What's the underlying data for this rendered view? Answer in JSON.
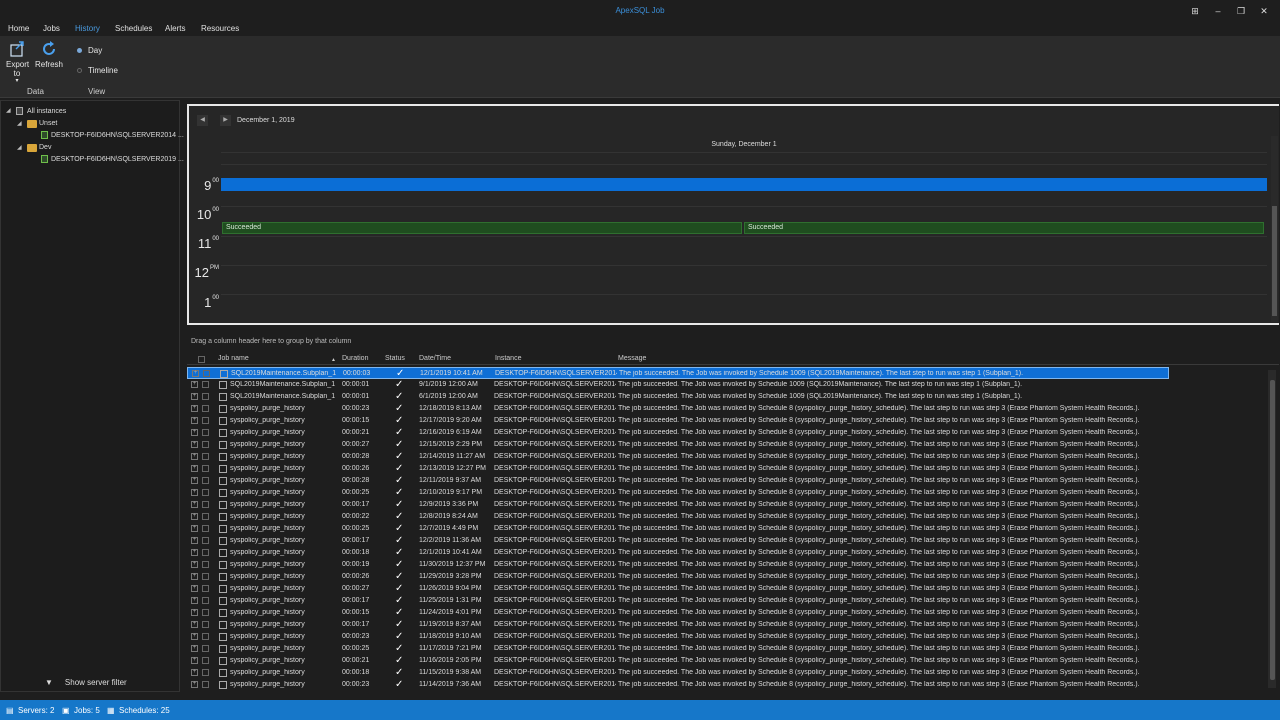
{
  "app": {
    "title": "ApexSQL Job"
  },
  "window": {
    "pin": "⊞",
    "minimize": "–",
    "restore": "❐",
    "close": "✕"
  },
  "menu": [
    "Home",
    "Jobs",
    "History",
    "Schedules",
    "Alerts",
    "Resources"
  ],
  "ribbon": {
    "export_label": "Export to",
    "export_arrow": "▾",
    "refresh_label": "Refresh",
    "day_label": "Day",
    "timeline_label": "Timeline",
    "group_data": "Data",
    "group_view": "View"
  },
  "tree": {
    "root": "All instances",
    "groups": [
      {
        "name": "Unset",
        "server": "DESKTOP-F6ID6HN\\SQLSERVER2014 ..."
      },
      {
        "name": "Dev",
        "server": "DESKTOP-F6ID6HN\\SQLSERVER2019 ..."
      }
    ]
  },
  "filter_label": "Show server filter",
  "calendar": {
    "date": "December 1, 2019",
    "day_header": "Sunday, December 1",
    "hours": [
      {
        "h": "9",
        "s": "00"
      },
      {
        "h": "10",
        "s": "00"
      },
      {
        "h": "11",
        "s": "00"
      },
      {
        "h": "12",
        "s": "PM"
      },
      {
        "h": "1",
        "s": "00"
      }
    ],
    "events": [
      "Succeeded",
      "Succeeded"
    ]
  },
  "grid": {
    "group_hint": "Drag a column header here to group by that column",
    "columns": [
      "Job name",
      "Duration",
      "Status",
      "Date/Time",
      "Instance",
      "Message"
    ],
    "sort_arrow": "▲",
    "status_glyph": "✓",
    "rows": [
      {
        "job": "SQL2019Maintenance.Subplan_1",
        "dur": "00:00:03",
        "dt": "12/1/2019 10:41 AM",
        "inst": "DESKTOP-F6ID6HN\\SQLSERVER2014",
        "msg": "The job succeeded.  The Job was invoked by Schedule 1009 (SQL2019Maintenance).  The last step to run was step 1 (Subplan_1)."
      },
      {
        "job": "SQL2019Maintenance.Subplan_1",
        "dur": "00:00:01",
        "dt": "9/1/2019 12:00 AM",
        "inst": "DESKTOP-F6ID6HN\\SQLSERVER2014",
        "msg": "The job succeeded.  The Job was invoked by Schedule 1009 (SQL2019Maintenance).  The last step to run was step 1 (Subplan_1)."
      },
      {
        "job": "SQL2019Maintenance.Subplan_1",
        "dur": "00:00:01",
        "dt": "6/1/2019 12:00 AM",
        "inst": "DESKTOP-F6ID6HN\\SQLSERVER2014",
        "msg": "The job succeeded.  The Job was invoked by Schedule 1009 (SQL2019Maintenance).  The last step to run was step 1 (Subplan_1)."
      },
      {
        "job": "syspolicy_purge_history",
        "dur": "00:00:23",
        "dt": "12/18/2019 8:13 AM",
        "inst": "DESKTOP-F6ID6HN\\SQLSERVER2014",
        "msg": "The job succeeded.  The Job was invoked by Schedule 8 (syspolicy_purge_history_schedule).  The last step to run was step 3 (Erase Phantom System Health Records.)."
      },
      {
        "job": "syspolicy_purge_history",
        "dur": "00:00:15",
        "dt": "12/17/2019 9:20 AM",
        "inst": "DESKTOP-F6ID6HN\\SQLSERVER2014",
        "msg": "The job succeeded.  The Job was invoked by Schedule 8 (syspolicy_purge_history_schedule).  The last step to run was step 3 (Erase Phantom System Health Records.)."
      },
      {
        "job": "syspolicy_purge_history",
        "dur": "00:00:21",
        "dt": "12/16/2019 6:19 AM",
        "inst": "DESKTOP-F6ID6HN\\SQLSERVER2014",
        "msg": "The job succeeded.  The Job was invoked by Schedule 8 (syspolicy_purge_history_schedule).  The last step to run was step 3 (Erase Phantom System Health Records.)."
      },
      {
        "job": "syspolicy_purge_history",
        "dur": "00:00:27",
        "dt": "12/15/2019 2:29 PM",
        "inst": "DESKTOP-F6ID6HN\\SQLSERVER2014",
        "msg": "The job succeeded.  The Job was invoked by Schedule 8 (syspolicy_purge_history_schedule).  The last step to run was step 3 (Erase Phantom System Health Records.)."
      },
      {
        "job": "syspolicy_purge_history",
        "dur": "00:00:28",
        "dt": "12/14/2019 11:27 AM",
        "inst": "DESKTOP-F6ID6HN\\SQLSERVER2014",
        "msg": "The job succeeded.  The Job was invoked by Schedule 8 (syspolicy_purge_history_schedule).  The last step to run was step 3 (Erase Phantom System Health Records.)."
      },
      {
        "job": "syspolicy_purge_history",
        "dur": "00:00:26",
        "dt": "12/13/2019 12:27 PM",
        "inst": "DESKTOP-F6ID6HN\\SQLSERVER2014",
        "msg": "The job succeeded.  The Job was invoked by Schedule 8 (syspolicy_purge_history_schedule).  The last step to run was step 3 (Erase Phantom System Health Records.)."
      },
      {
        "job": "syspolicy_purge_history",
        "dur": "00:00:28",
        "dt": "12/11/2019 9:37 AM",
        "inst": "DESKTOP-F6ID6HN\\SQLSERVER2014",
        "msg": "The job succeeded.  The Job was invoked by Schedule 8 (syspolicy_purge_history_schedule).  The last step to run was step 3 (Erase Phantom System Health Records.)."
      },
      {
        "job": "syspolicy_purge_history",
        "dur": "00:00:25",
        "dt": "12/10/2019 9:17 PM",
        "inst": "DESKTOP-F6ID6HN\\SQLSERVER2014",
        "msg": "The job succeeded.  The Job was invoked by Schedule 8 (syspolicy_purge_history_schedule).  The last step to run was step 3 (Erase Phantom System Health Records.)."
      },
      {
        "job": "syspolicy_purge_history",
        "dur": "00:00:17",
        "dt": "12/9/2019 3:36 PM",
        "inst": "DESKTOP-F6ID6HN\\SQLSERVER2014",
        "msg": "The job succeeded.  The Job was invoked by Schedule 8 (syspolicy_purge_history_schedule).  The last step to run was step 3 (Erase Phantom System Health Records.)."
      },
      {
        "job": "syspolicy_purge_history",
        "dur": "00:00:22",
        "dt": "12/8/2019 8:24 AM",
        "inst": "DESKTOP-F6ID6HN\\SQLSERVER2014",
        "msg": "The job succeeded.  The Job was invoked by Schedule 8 (syspolicy_purge_history_schedule).  The last step to run was step 3 (Erase Phantom System Health Records.)."
      },
      {
        "job": "syspolicy_purge_history",
        "dur": "00:00:25",
        "dt": "12/7/2019 4:49 PM",
        "inst": "DESKTOP-F6ID6HN\\SQLSERVER2014",
        "msg": "The job succeeded.  The Job was invoked by Schedule 8 (syspolicy_purge_history_schedule).  The last step to run was step 3 (Erase Phantom System Health Records.)."
      },
      {
        "job": "syspolicy_purge_history",
        "dur": "00:00:17",
        "dt": "12/2/2019 11:36 AM",
        "inst": "DESKTOP-F6ID6HN\\SQLSERVER2014",
        "msg": "The job succeeded.  The Job was invoked by Schedule 8 (syspolicy_purge_history_schedule).  The last step to run was step 3 (Erase Phantom System Health Records.)."
      },
      {
        "job": "syspolicy_purge_history",
        "dur": "00:00:18",
        "dt": "12/1/2019 10:41 AM",
        "inst": "DESKTOP-F6ID6HN\\SQLSERVER2014",
        "msg": "The job succeeded.  The Job was invoked by Schedule 8 (syspolicy_purge_history_schedule).  The last step to run was step 3 (Erase Phantom System Health Records.)."
      },
      {
        "job": "syspolicy_purge_history",
        "dur": "00:00:19",
        "dt": "11/30/2019 12:37 PM",
        "inst": "DESKTOP-F6ID6HN\\SQLSERVER2014",
        "msg": "The job succeeded.  The Job was invoked by Schedule 8 (syspolicy_purge_history_schedule).  The last step to run was step 3 (Erase Phantom System Health Records.)."
      },
      {
        "job": "syspolicy_purge_history",
        "dur": "00:00:26",
        "dt": "11/29/2019 3:28 PM",
        "inst": "DESKTOP-F6ID6HN\\SQLSERVER2014",
        "msg": "The job succeeded.  The Job was invoked by Schedule 8 (syspolicy_purge_history_schedule).  The last step to run was step 3 (Erase Phantom System Health Records.)."
      },
      {
        "job": "syspolicy_purge_history",
        "dur": "00:00:27",
        "dt": "11/26/2019 9:04 PM",
        "inst": "DESKTOP-F6ID6HN\\SQLSERVER2014",
        "msg": "The job succeeded.  The Job was invoked by Schedule 8 (syspolicy_purge_history_schedule).  The last step to run was step 3 (Erase Phantom System Health Records.)."
      },
      {
        "job": "syspolicy_purge_history",
        "dur": "00:00:17",
        "dt": "11/25/2019 1:31 PM",
        "inst": "DESKTOP-F6ID6HN\\SQLSERVER2014",
        "msg": "The job succeeded.  The Job was invoked by Schedule 8 (syspolicy_purge_history_schedule).  The last step to run was step 3 (Erase Phantom System Health Records.)."
      },
      {
        "job": "syspolicy_purge_history",
        "dur": "00:00:15",
        "dt": "11/24/2019 4:01 PM",
        "inst": "DESKTOP-F6ID6HN\\SQLSERVER2014",
        "msg": "The job succeeded.  The Job was invoked by Schedule 8 (syspolicy_purge_history_schedule).  The last step to run was step 3 (Erase Phantom System Health Records.)."
      },
      {
        "job": "syspolicy_purge_history",
        "dur": "00:00:17",
        "dt": "11/19/2019 8:37 AM",
        "inst": "DESKTOP-F6ID6HN\\SQLSERVER2014",
        "msg": "The job succeeded.  The Job was invoked by Schedule 8 (syspolicy_purge_history_schedule).  The last step to run was step 3 (Erase Phantom System Health Records.)."
      },
      {
        "job": "syspolicy_purge_history",
        "dur": "00:00:23",
        "dt": "11/18/2019 9:10 AM",
        "inst": "DESKTOP-F6ID6HN\\SQLSERVER2014",
        "msg": "The job succeeded.  The Job was invoked by Schedule 8 (syspolicy_purge_history_schedule).  The last step to run was step 3 (Erase Phantom System Health Records.)."
      },
      {
        "job": "syspolicy_purge_history",
        "dur": "00:00:25",
        "dt": "11/17/2019 7:21 PM",
        "inst": "DESKTOP-F6ID6HN\\SQLSERVER2014",
        "msg": "The job succeeded.  The Job was invoked by Schedule 8 (syspolicy_purge_history_schedule).  The last step to run was step 3 (Erase Phantom System Health Records.)."
      },
      {
        "job": "syspolicy_purge_history",
        "dur": "00:00:21",
        "dt": "11/16/2019 2:05 PM",
        "inst": "DESKTOP-F6ID6HN\\SQLSERVER2014",
        "msg": "The job succeeded.  The Job was invoked by Schedule 8 (syspolicy_purge_history_schedule).  The last step to run was step 3 (Erase Phantom System Health Records.)."
      },
      {
        "job": "syspolicy_purge_history",
        "dur": "00:00:18",
        "dt": "11/15/2019 9:38 AM",
        "inst": "DESKTOP-F6ID6HN\\SQLSERVER2014",
        "msg": "The job succeeded.  The Job was invoked by Schedule 8 (syspolicy_purge_history_schedule).  The last step to run was step 3 (Erase Phantom System Health Records.)."
      },
      {
        "job": "syspolicy_purge_history",
        "dur": "00:00:23",
        "dt": "11/14/2019 7:36 AM",
        "inst": "DESKTOP-F6ID6HN\\SQLSERVER2014",
        "msg": "The job succeeded.  The Job was invoked by Schedule 8 (syspolicy_purge_history_schedule).  The last step to run was step 3 (Erase Phantom System Health Records.)."
      }
    ]
  },
  "status": {
    "servers": "Servers: 2",
    "jobs": "Jobs: 5",
    "schedules": "Schedules: 25"
  },
  "colors": {
    "accent": "#1677c9",
    "selection": "#0f6fd6",
    "success_event": "#1f4d1f",
    "highlight_bar": "#0b6ed6"
  }
}
